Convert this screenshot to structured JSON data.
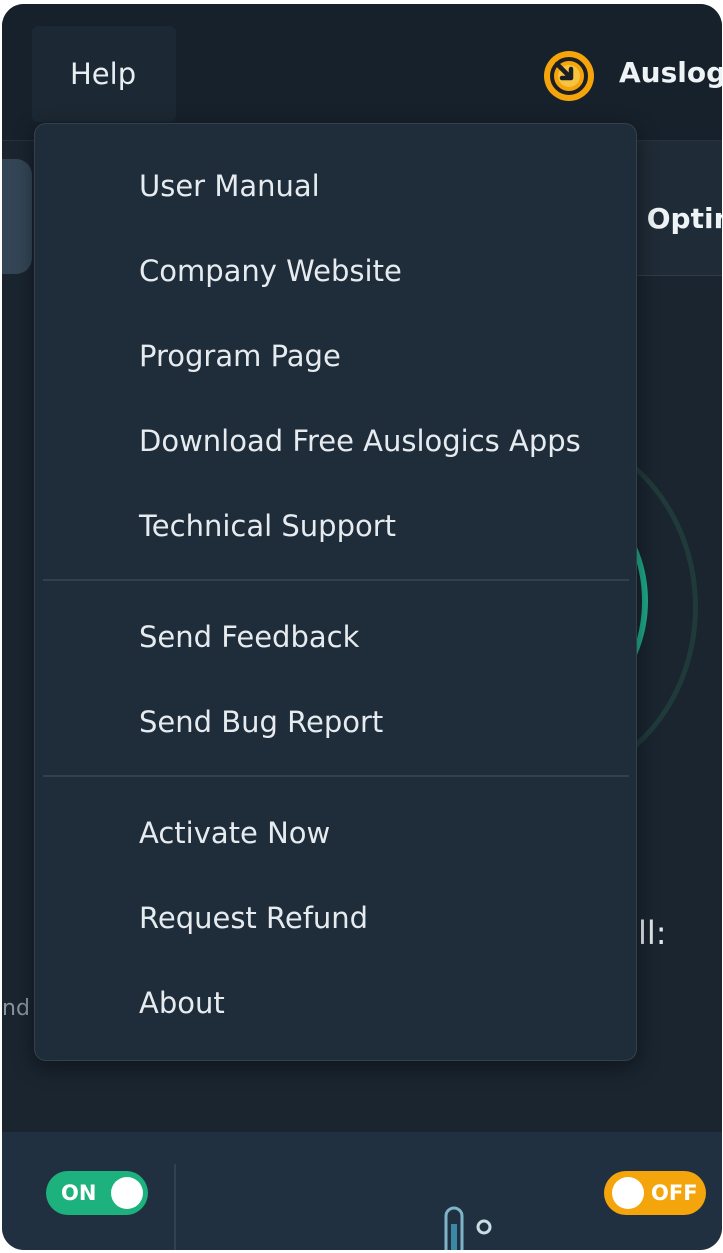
{
  "topbar": {
    "help_label": "Help",
    "brand_name": "Auslogics"
  },
  "panel": {
    "optimization_title": "e Optim",
    "right_label": "ll:",
    "left_text": "nd"
  },
  "help_menu": {
    "items": [
      "User Manual",
      "Company Website",
      "Program Page",
      "Download Free Auslogics Apps",
      "Technical Support",
      "Send Feedback",
      "Send Bug Report",
      "Activate Now",
      "Request Refund",
      "About"
    ]
  },
  "toggles": {
    "left": {
      "label": "ON",
      "state": true
    },
    "right": {
      "label": "OFF",
      "state": false
    }
  },
  "colors": {
    "background": "#1a2530",
    "menu_bg": "#1f2c3a",
    "on_green": "#1db27d",
    "off_orange": "#f5a50c",
    "logo_orange": "#f5a40c"
  },
  "icons": {
    "logo": "auslogics-logo-icon",
    "gauge": "gauge-icon",
    "thermometer": "thermometer-icon"
  }
}
